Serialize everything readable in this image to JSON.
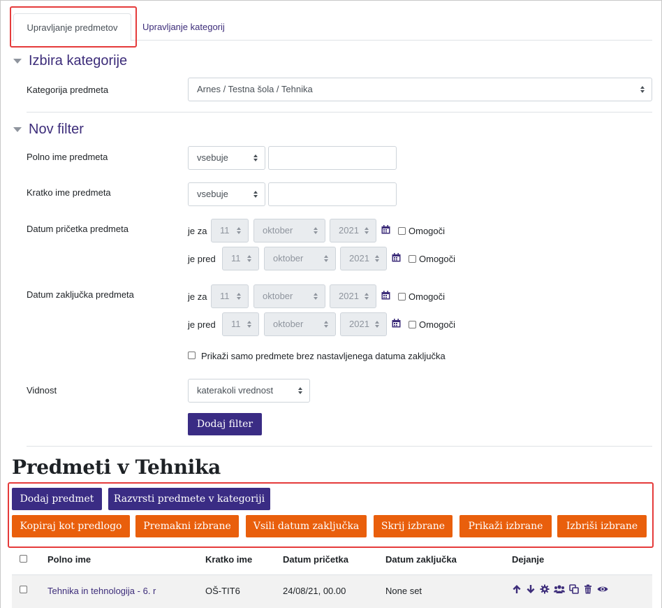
{
  "tabs": {
    "manage_courses": "Upravljanje predmetov",
    "manage_categories": "Upravljanje kategorij"
  },
  "category_section": {
    "title": "Izbira kategorije",
    "label": "Kategorija predmeta",
    "selected": "Arnes / Testna šola / Tehnika"
  },
  "filter_section": {
    "title": "Nov filter",
    "fullname": {
      "label": "Polno ime predmeta",
      "operator": "vsebuje",
      "value": ""
    },
    "shortname": {
      "label": "Kratko ime predmeta",
      "operator": "vsebuje",
      "value": ""
    },
    "startdate": {
      "label": "Datum pričetka predmeta",
      "after": {
        "prefix": "je za",
        "day": "11",
        "month": "oktober",
        "year": "2021",
        "enable_label": "Omogoči"
      },
      "before": {
        "prefix": "je pred",
        "day": "11",
        "month": "oktober",
        "year": "2021",
        "enable_label": "Omogoči"
      }
    },
    "enddate": {
      "label": "Datum zaključka predmeta",
      "after": {
        "prefix": "je za",
        "day": "11",
        "month": "oktober",
        "year": "2021",
        "enable_label": "Omogoči"
      },
      "before": {
        "prefix": "je pred",
        "day": "11",
        "month": "oktober",
        "year": "2021",
        "enable_label": "Omogoči"
      },
      "no_enddate_label": "Prikaži samo predmete brez nastavljenega datuma zaključka"
    },
    "visibility": {
      "label": "Vidnost",
      "selected": "katerakoli vrednost"
    },
    "add_filter_button": "Dodaj filter"
  },
  "courses": {
    "title": "Predmeti v Tehnika",
    "buttons": {
      "add_course": "Dodaj predmet",
      "sort_courses": "Razvrsti predmete v kategoriji",
      "copy_as_template": "Kopiraj kot predlogo",
      "move_selected": "Premakni izbrane",
      "force_enddate": "Vsili datum zaključka",
      "hide_selected": "Skrij izbrane",
      "show_selected": "Prikaži izbrane",
      "delete_selected": "Izbriši izbrane"
    },
    "table": {
      "headers": [
        "Polno ime",
        "Kratko ime",
        "Datum pričetka",
        "Datum zaključka",
        "Dejanje"
      ],
      "rows": [
        {
          "fullname": "Tehnika in tehnologija - 6. r",
          "shortname": "OŠ-TIT6",
          "startdate": "24/08/21, 00.00",
          "enddate": "None set"
        }
      ],
      "action_icons": [
        "arrow-up-icon",
        "arrow-down-icon",
        "gear-icon",
        "users-icon",
        "copy-icon",
        "trash-icon",
        "eye-icon"
      ]
    }
  },
  "colors": {
    "primary": "#3a2c84",
    "orange": "#e95f0c",
    "link": "#3d2d7a",
    "highlight": "#e53b3b"
  }
}
